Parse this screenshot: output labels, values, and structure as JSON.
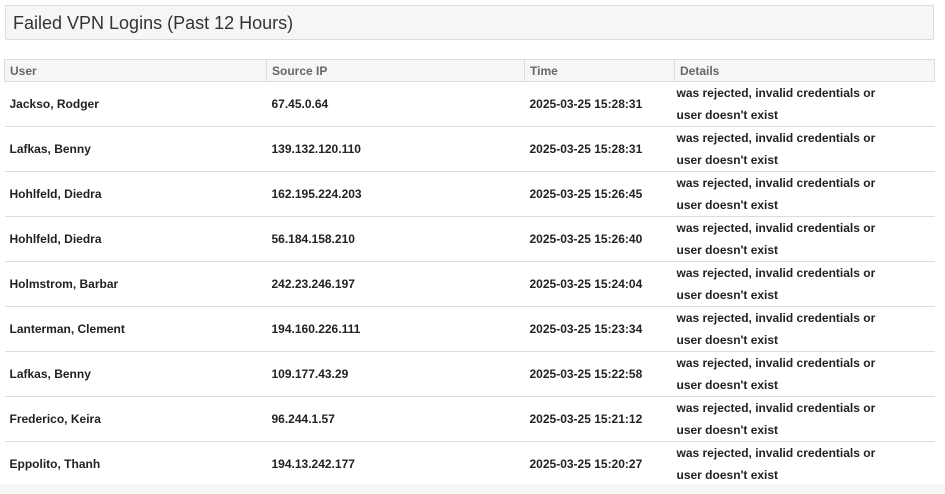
{
  "panel": {
    "title": "Failed VPN Logins (Past 12 Hours)"
  },
  "table": {
    "headers": {
      "user": "User",
      "source_ip": "Source IP",
      "time": "Time",
      "details": "Details"
    },
    "rows": [
      {
        "user": "Jackso, Rodger",
        "source_ip": "67.45.0.64",
        "time": "2025-03-25 15:28:31",
        "details": "was rejected, invalid credentials or user doesn't exist"
      },
      {
        "user": "Lafkas, Benny",
        "source_ip": "139.132.120.110",
        "time": "2025-03-25 15:28:31",
        "details": "was rejected, invalid credentials or user doesn't exist"
      },
      {
        "user": "Hohlfeld, Diedra",
        "source_ip": "162.195.224.203",
        "time": "2025-03-25 15:26:45",
        "details": "was rejected, invalid credentials or user doesn't exist"
      },
      {
        "user": "Hohlfeld, Diedra",
        "source_ip": "56.184.158.210",
        "time": "2025-03-25 15:26:40",
        "details": "was rejected, invalid credentials or user doesn't exist"
      },
      {
        "user": "Holmstrom, Barbar",
        "source_ip": "242.23.246.197",
        "time": "2025-03-25 15:24:04",
        "details": "was rejected, invalid credentials or user doesn't exist"
      },
      {
        "user": "Lanterman, Clement",
        "source_ip": "194.160.226.111",
        "time": "2025-03-25 15:23:34",
        "details": "was rejected, invalid credentials or user doesn't exist"
      },
      {
        "user": "Lafkas, Benny",
        "source_ip": "109.177.43.29",
        "time": "2025-03-25 15:22:58",
        "details": "was rejected, invalid credentials or user doesn't exist"
      },
      {
        "user": "Frederico, Keira",
        "source_ip": "96.244.1.57",
        "time": "2025-03-25 15:21:12",
        "details": "was rejected, invalid credentials or user doesn't exist"
      },
      {
        "user": "Eppolito, Thanh",
        "source_ip": "194.13.242.177",
        "time": "2025-03-25 15:20:27",
        "details": "was rejected, invalid credentials or user doesn't exist"
      }
    ]
  }
}
